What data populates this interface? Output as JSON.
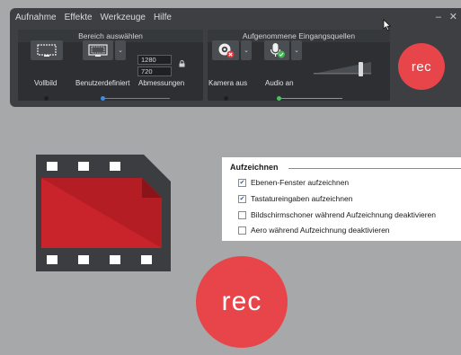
{
  "menu": {
    "items": [
      "Aufnahme",
      "Effekte",
      "Werkzeuge",
      "Hilfe"
    ],
    "minimize": "–",
    "close": "✕"
  },
  "panel_select": {
    "title": "Bereich auswählen",
    "fullscreen_label": "Vollbild",
    "custom_label": "Benutzerdefiniert",
    "dimensions_label": "Abmessungen",
    "width": "1280",
    "height": "720",
    "dropdown": "⌄"
  },
  "panel_input": {
    "title": "Aufgenommene Eingangsquellen",
    "camera_label": "Kamera aus",
    "audio_label": "Audio an",
    "dropdown": "⌄"
  },
  "rec_small": "rec",
  "rec_big": "rec",
  "settings": {
    "title": "Aufzeichnen",
    "options": [
      {
        "label": "Ebenen-Fenster aufzeichnen",
        "checked": true
      },
      {
        "label": "Tastatureingaben aufzeichnen",
        "checked": true
      },
      {
        "label": "Bildschirmschoner während Aufzeichnung deaktivieren",
        "checked": false
      },
      {
        "label": "Aero während Aufzeichnung deaktivieren",
        "checked": false
      }
    ]
  },
  "colors": {
    "rec": "#e8454a",
    "select_accent": "#3a8ee6",
    "input_accent": "#4cc25a",
    "film_red": "#c9232b"
  }
}
